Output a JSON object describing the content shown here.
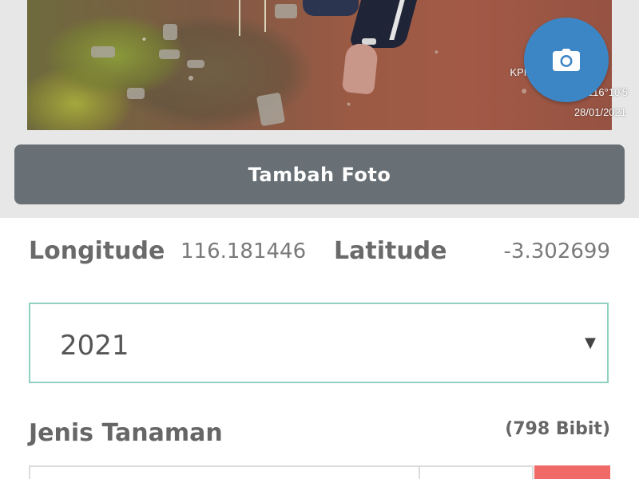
{
  "photo": {
    "stamp_line1": "KPH Pulau",
    "stamp_line2": "-3°18'9\", 116°10'5",
    "stamp_line3": "28/01/2021"
  },
  "camera_button": {
    "icon": "camera-icon"
  },
  "add_photo_button": {
    "label": "Tambah Foto"
  },
  "coordinates": {
    "longitude_label": "Longitude",
    "longitude_value": "116.181446",
    "latitude_label": "Latitude",
    "latitude_value": "-3.302699"
  },
  "year_select": {
    "value": "2021",
    "caret": "▼"
  },
  "plants": {
    "title": "Jenis Tanaman",
    "count": "(798 Bibit)"
  },
  "colors": {
    "button_bg": "#687075",
    "fab_bg": "#3d86c6",
    "select_border": "#8fd0c0",
    "delete_bg": "#f06a67"
  }
}
